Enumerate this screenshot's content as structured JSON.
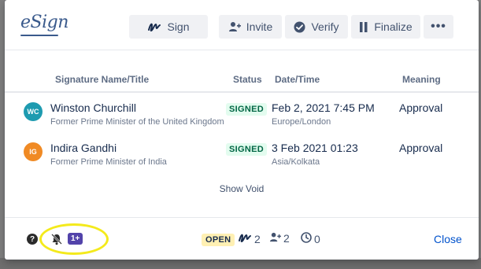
{
  "header": {
    "logo_text": "eSign",
    "buttons": {
      "sign": "Sign",
      "invite": "Invite",
      "verify": "Verify",
      "finalize": "Finalize",
      "more": "•••"
    }
  },
  "table": {
    "columns": {
      "name": "Signature Name/Title",
      "status": "Status",
      "date": "Date/Time",
      "meaning": "Meaning"
    },
    "rows": [
      {
        "initials": "WC",
        "avatar_color": "#1e9bb0",
        "name": "Winston Churchill",
        "title": "Former Prime Minister of the United Kingdom",
        "status": "SIGNED",
        "date": "Feb 2, 2021 7:45 PM",
        "timezone": "Europe/London",
        "meaning": "Approval"
      },
      {
        "initials": "IG",
        "avatar_color": "#f08a24",
        "name": "Indira Gandhi",
        "title": "Former Prime Minister of India",
        "status": "SIGNED",
        "date": "3 Feb 2021 01:23",
        "timezone": "Asia/Kolkata",
        "meaning": "Approval"
      }
    ],
    "show_void": "Show Void"
  },
  "footer": {
    "help": "?",
    "watch_count_badge": "1+",
    "status": "OPEN",
    "signed_count": "2",
    "invited_count": "2",
    "pending_count": "0",
    "close": "Close"
  },
  "colors": {
    "accent": "#0052cc",
    "signed_bg": "#e3fcef",
    "open_bg": "#fff0b3",
    "badge_purple": "#5243aa",
    "highlight": "#f4ea1c"
  },
  "icons": [
    "signature-icon",
    "add-user-icon",
    "check-circle-icon",
    "finalize-icon",
    "more-icon",
    "help-icon",
    "bell-off-icon",
    "clock-icon"
  ]
}
